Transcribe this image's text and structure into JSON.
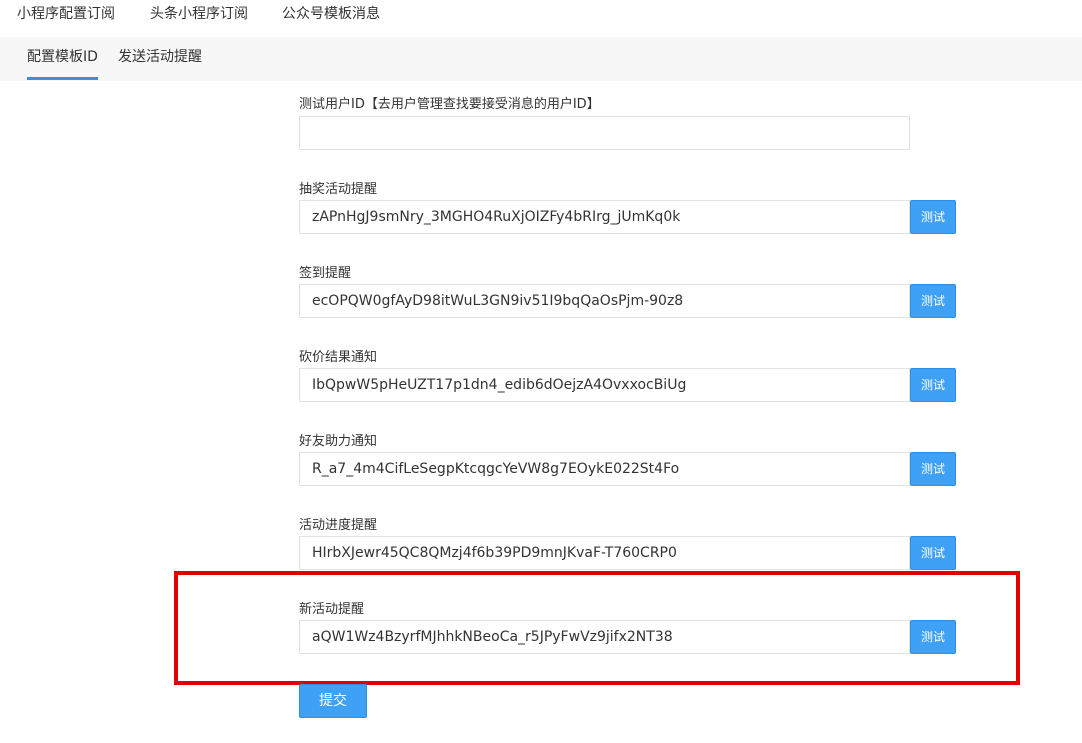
{
  "top_tabs": [
    {
      "label": "小程序配置订阅"
    },
    {
      "label": "头条小程序订阅"
    },
    {
      "label": "公众号模板消息"
    }
  ],
  "sub_tabs": [
    {
      "label": "配置模板ID",
      "active": true
    },
    {
      "label": "发送活动提醒",
      "active": false
    }
  ],
  "test_user": {
    "label": "测试用户ID【去用户管理查找要接受消息的用户ID】",
    "value": ""
  },
  "fields": [
    {
      "label": "抽奖活动提醒",
      "value": "zAPnHgJ9smNry_3MGHO4RuXjOIZFy4bRIrg_jUmKq0k",
      "button": "测试"
    },
    {
      "label": "签到提醒",
      "value": "ecOPQW0gfAyD98itWuL3GN9iv51I9bqQaOsPjm-90z8",
      "button": "测试"
    },
    {
      "label": "砍价结果通知",
      "value": "IbQpwW5pHeUZT17p1dn4_edib6dOejzA4OvxxocBiUg",
      "button": "测试"
    },
    {
      "label": "好友助力通知",
      "value": "R_a7_4m4CifLeSegpKtcqgcYeVW8g7EOykE022St4Fo",
      "button": "测试"
    },
    {
      "label": "活动进度提醒",
      "value": "HIrbXJewr45QC8QMzj4f6b39PD9mnJKvaF-T760CRP0",
      "button": "测试"
    },
    {
      "label": "新活动提醒",
      "value": "aQW1Wz4BzyrfMJhhkNBeoCa_r5JPyFwVz9jifx2NT38",
      "button": "测试"
    }
  ],
  "submit_label": "提交",
  "colors": {
    "accent": "#3ea1f5",
    "highlight": "#e00000"
  }
}
